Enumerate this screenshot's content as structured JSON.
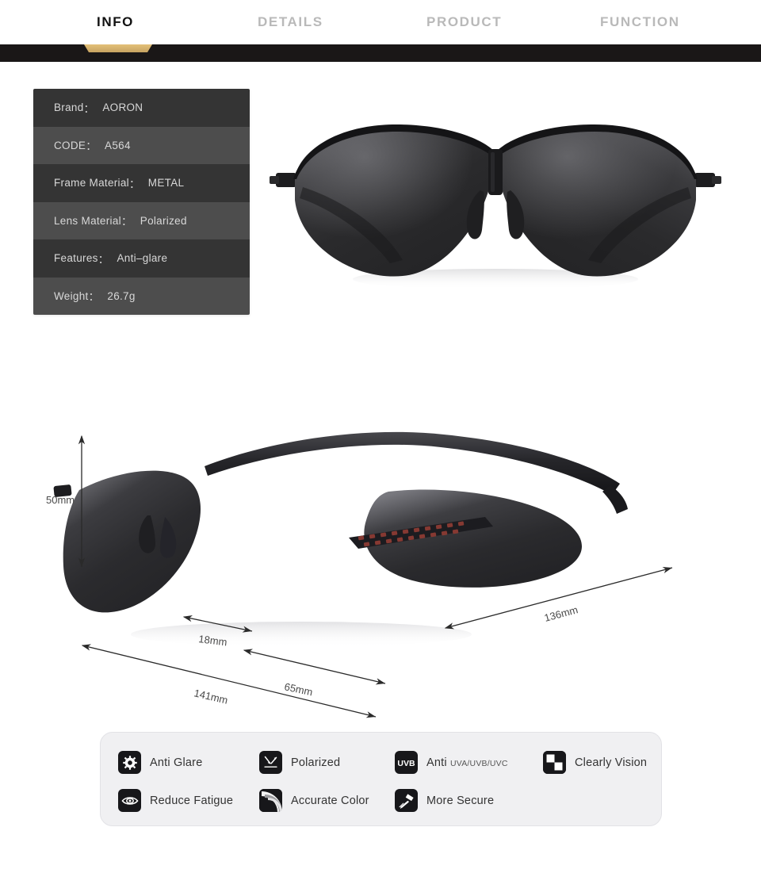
{
  "nav": {
    "tabs": [
      {
        "label": "INFO",
        "active": true
      },
      {
        "label": "DETAILS",
        "active": false
      },
      {
        "label": "PRODUCT",
        "active": false
      },
      {
        "label": "FUNCTION",
        "active": false
      }
    ],
    "active_marker_color": "#d8b46f",
    "bar_color": "#1a1717"
  },
  "spec_table": {
    "rows": [
      {
        "label": "Brand",
        "colon": "：",
        "value": "AORON"
      },
      {
        "label": "CODE",
        "colon": "：",
        "value": "A564"
      },
      {
        "label": "Frame Material",
        "colon": "：",
        "value": "METAL"
      },
      {
        "label": "Lens Material",
        "colon": "：",
        "value": "Polarized"
      },
      {
        "label": "Features",
        "colon": "：",
        "value": "Anti–glare"
      },
      {
        "label": "Weight",
        "colon": "：",
        "value": "26.7g"
      }
    ],
    "row_color_odd": "#343434",
    "row_color_even": "#4d4d4d",
    "text_color": "#d8d8d8"
  },
  "hero": {
    "alt": "aviator rimless sunglasses front view",
    "lens_color": "#2b2b2d",
    "frame_color": "#1b1b1d"
  },
  "dimensions": {
    "height": "50mm",
    "bridge": "18mm",
    "lens_width": "65mm",
    "total_width": "141mm",
    "temple_length": "136mm",
    "product_alt": "aviator rimless sunglasses angled view with red carbon pattern temple"
  },
  "features": {
    "items": [
      {
        "label": "Anti Glare",
        "sub": "",
        "icon": "sun-icon"
      },
      {
        "label": "Polarized",
        "sub": "",
        "icon": "reflection-arrows-icon"
      },
      {
        "label": "Anti ",
        "sub": "UVA/UVB/UVC",
        "icon": "uvb-badge-icon"
      },
      {
        "label": "Clearly Vision",
        "sub": "",
        "icon": "checkerboard-icon"
      },
      {
        "label": "Reduce Fatigue",
        "sub": "",
        "icon": "eye-icon"
      },
      {
        "label": "Accurate Color",
        "sub": "",
        "icon": "color-arc-icon"
      },
      {
        "label": "More Secure",
        "sub": "",
        "icon": "hammer-icon"
      }
    ],
    "uvb_badge_text": "UVB",
    "panel_bg": "#f0f0f2"
  }
}
